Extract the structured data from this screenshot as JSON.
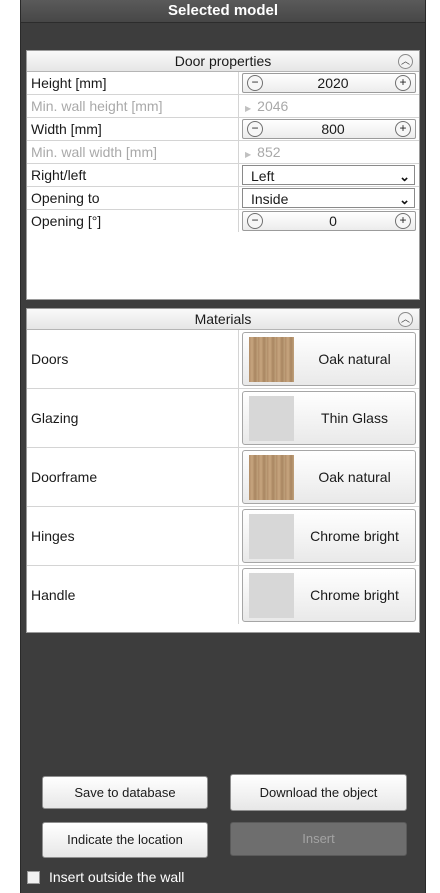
{
  "title": "Selected model",
  "door_properties": {
    "header": "Door properties",
    "height": {
      "label": "Height [mm]",
      "value": "2020"
    },
    "min_wall_height": {
      "label": "Min. wall height [mm]",
      "value": "2046"
    },
    "width": {
      "label": "Width [mm]",
      "value": "800"
    },
    "min_wall_width": {
      "label": "Min. wall width [mm]",
      "value": "852"
    },
    "right_left": {
      "label": "Right/left",
      "value": "Left"
    },
    "opening_to": {
      "label": "Opening to",
      "value": "Inside"
    },
    "opening": {
      "label": "Opening [°]",
      "value": "0"
    }
  },
  "materials": {
    "header": "Materials",
    "doors": {
      "label": "Doors",
      "value": "Oak natural"
    },
    "glazing": {
      "label": "Glazing",
      "value": "Thin Glass"
    },
    "doorframe": {
      "label": "Doorframe",
      "value": "Oak natural"
    },
    "hinges": {
      "label": "Hinges",
      "value": "Chrome bright"
    },
    "handle": {
      "label": "Handle",
      "value": "Chrome bright"
    }
  },
  "buttons": {
    "save": "Save to database",
    "download": "Download the object",
    "indicate": "Indicate the location",
    "insert": "Insert"
  },
  "checkbox_label": "Insert outside the wall",
  "icons": {
    "collapse": "collapse-up-icon",
    "minus": "minus-icon",
    "plus": "plus-icon",
    "dropdown": "chevron-down-icon"
  }
}
